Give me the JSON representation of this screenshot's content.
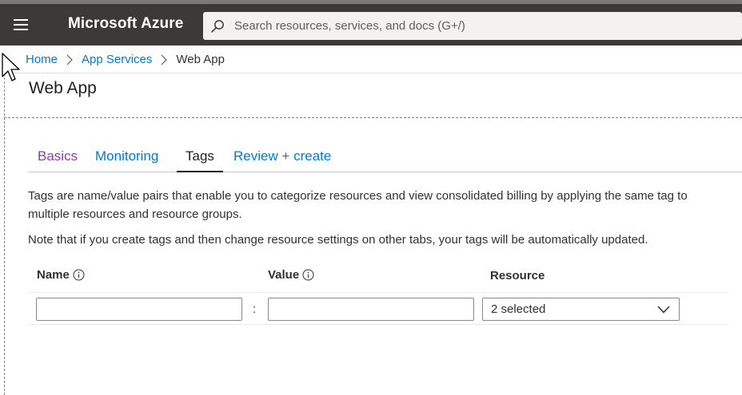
{
  "header": {
    "brand": "Microsoft Azure",
    "search_placeholder": "Search resources, services, and docs (G+/)",
    "menu_icon": "hamburger-menu-icon",
    "search_icon": "search-icon"
  },
  "breadcrumb": {
    "items": [
      {
        "label": "Home"
      },
      {
        "label": "App Services"
      }
    ],
    "current": "Web App"
  },
  "page": {
    "title": "Web App"
  },
  "tabs": [
    {
      "label": "Basics",
      "state": "visited"
    },
    {
      "label": "Monitoring",
      "state": "link"
    },
    {
      "label": "Tags",
      "state": "active"
    },
    {
      "label": "Review + create",
      "state": "link"
    }
  ],
  "content": {
    "description": "Tags are name/value pairs that enable you to categorize resources and view consolidated billing by applying the same tag to multiple resources and resource groups.",
    "note": "Note that if you create tags and then change resource settings on other tabs, your tags will be automatically updated."
  },
  "tags_table": {
    "columns": [
      {
        "label": "Name",
        "info_icon": "info-icon"
      },
      {
        "label": "Value",
        "info_icon": "info-icon"
      },
      {
        "label": "Resource"
      }
    ],
    "row": {
      "name_value": "",
      "separator": ":",
      "value_value": "",
      "resource_selected": "2 selected"
    }
  },
  "colors": {
    "topbar": "#3b3a39",
    "link": "#0078d4",
    "visited": "#8a3f9e",
    "text": "#323130"
  }
}
